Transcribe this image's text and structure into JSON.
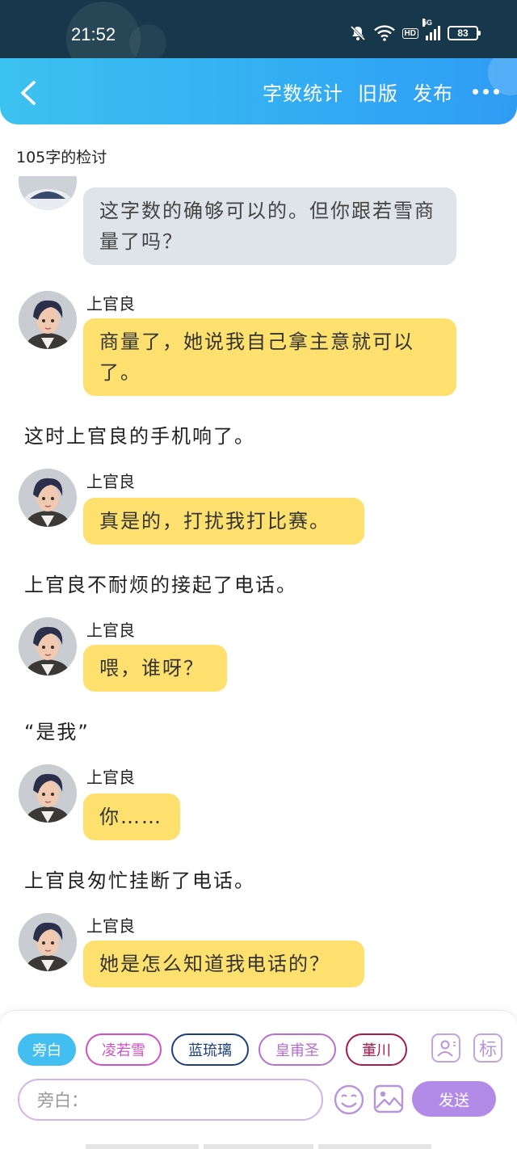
{
  "status_bar": {
    "time": "21:52",
    "network": "5G",
    "hd": "HD",
    "battery": "83"
  },
  "header": {
    "nav": [
      {
        "label": "字数统计"
      },
      {
        "label": "旧版"
      },
      {
        "label": "发布"
      }
    ]
  },
  "story": {
    "title": "105字的检讨",
    "partial_bubble": "这字数的确够可以的。但你跟若雪商量了吗？",
    "entries": [
      {
        "speaker": "上官良",
        "text": "商量了，她说我自己拿主意就可以了。"
      },
      {
        "narration": "这时上官良的手机响了。"
      },
      {
        "speaker": "上官良",
        "text": "真是的，打扰我打比赛。"
      },
      {
        "narration": "上官良不耐烦的接起了电话。"
      },
      {
        "speaker": "上官良",
        "text": "喂，谁呀？"
      },
      {
        "narration": "“是我”"
      },
      {
        "speaker": "上官良",
        "text": "你……"
      },
      {
        "narration": "上官良匆忙挂断了电话。"
      },
      {
        "speaker": "上官良",
        "text": "她是怎么知道我电话的？"
      }
    ]
  },
  "composer": {
    "characters": [
      {
        "label": "旁白",
        "color": "#42bef0",
        "selected": true
      },
      {
        "label": "凌若雪",
        "color": "#d24fc9",
        "selected": false
      },
      {
        "label": "蓝琉璃",
        "color": "#1d3f7c",
        "selected": false
      },
      {
        "label": "皇甫圣",
        "color": "#b86fd3",
        "selected": false
      },
      {
        "label": "董川",
        "color": "#a61a4d",
        "selected": false
      }
    ],
    "tag_label": "标",
    "input_placeholder": "旁白：",
    "send_label": "发送"
  }
}
